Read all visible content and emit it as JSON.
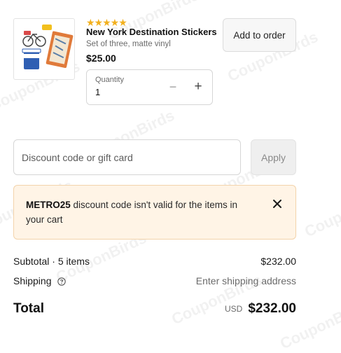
{
  "product": {
    "rating_stars": "★★★★★",
    "name": "New York Destination Stickers",
    "description": "Set of three, matte vinyl",
    "price": "$25.00",
    "add_label": "Add to order",
    "quantity_label": "Quantity",
    "quantity_value": "1",
    "minus_symbol": "−",
    "plus_symbol": "+"
  },
  "discount": {
    "placeholder": "Discount code or gift card",
    "value": "",
    "apply_label": "Apply"
  },
  "error_banner": {
    "code": "METRO25",
    "message": " discount code isn't valid for the items in your cart"
  },
  "summary": {
    "subtotal_label": "Subtotal · 5 items",
    "subtotal_value": "$232.00",
    "shipping_label": "Shipping",
    "shipping_value": "Enter shipping address",
    "total_label": "Total",
    "total_currency": "USD",
    "total_value": "$232.00"
  },
  "watermark": "CouponBirds",
  "colors": {
    "star": "#f2b01e",
    "banner_bg": "#fff4e6",
    "banner_border": "#f3d3ab"
  }
}
